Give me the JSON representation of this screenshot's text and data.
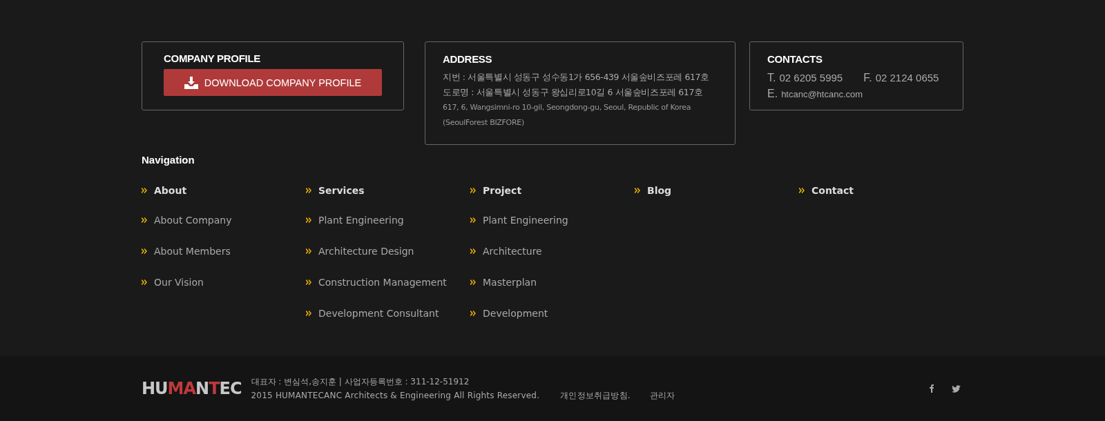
{
  "company_profile": {
    "title": "COMPANY PROFILE",
    "button": "DOWNLOAD COMPANY PROFILE"
  },
  "address": {
    "title": "ADDRESS",
    "lines": [
      "지번 : 서울특별시  성동구 성수동1가 656-439 서울숲비즈포레 617호",
      "도로명 : 서울특별시 성동구 왕십리로10길 6 서울숲비즈포레 617호"
    ],
    "english_lines": [
      "617, 6, Wangsimni-ro 10-gil, Seongdong-gu, Seoul, Republic of Korea",
      "(SeoulForest BIZFORE)"
    ]
  },
  "contacts": {
    "title": "CONTACTS",
    "phone_label": "T.",
    "phone": "02 6205 5995",
    "fax_label": "F.",
    "fax": "02 2124 0655",
    "email_label": "E.",
    "email": "htcanc@htcanc.com"
  },
  "navigation": {
    "title": "Navigation",
    "columns": [
      {
        "heading": "About",
        "items": [
          "About Company",
          "About Members",
          "Our Vision"
        ]
      },
      {
        "heading": "Services",
        "items": [
          "Plant Engineering",
          "Architecture Design",
          "Construction Management",
          "Development Consultant"
        ]
      },
      {
        "heading": "Project",
        "items": [
          "Plant Engineering",
          "Architecture",
          "Masterplan",
          "Development"
        ]
      },
      {
        "heading": "Blog"
      },
      {
        "heading": "Contact"
      }
    ]
  },
  "footer": {
    "logo_parts": [
      {
        "text": "HU",
        "color": "#c8c8c8"
      },
      {
        "text": "MA",
        "color": "#c0393b"
      },
      {
        "text": "N",
        "color": "#c8c8c8"
      },
      {
        "text": "T",
        "color": "#c0393b"
      },
      {
        "text": "EC",
        "color": "#c8c8c8"
      }
    ],
    "business_info": "대표자 : 변심석,송지훈 | 사업자등록번호 : 311-12-51912",
    "copyright": "2015 HUMANTECANC Architects & Engineering All Rights Reserved.",
    "links": [
      "개인정보취급방침.",
      "관리자"
    ],
    "social": [
      {
        "kind": "facebook"
      },
      {
        "kind": "twitter"
      }
    ]
  }
}
